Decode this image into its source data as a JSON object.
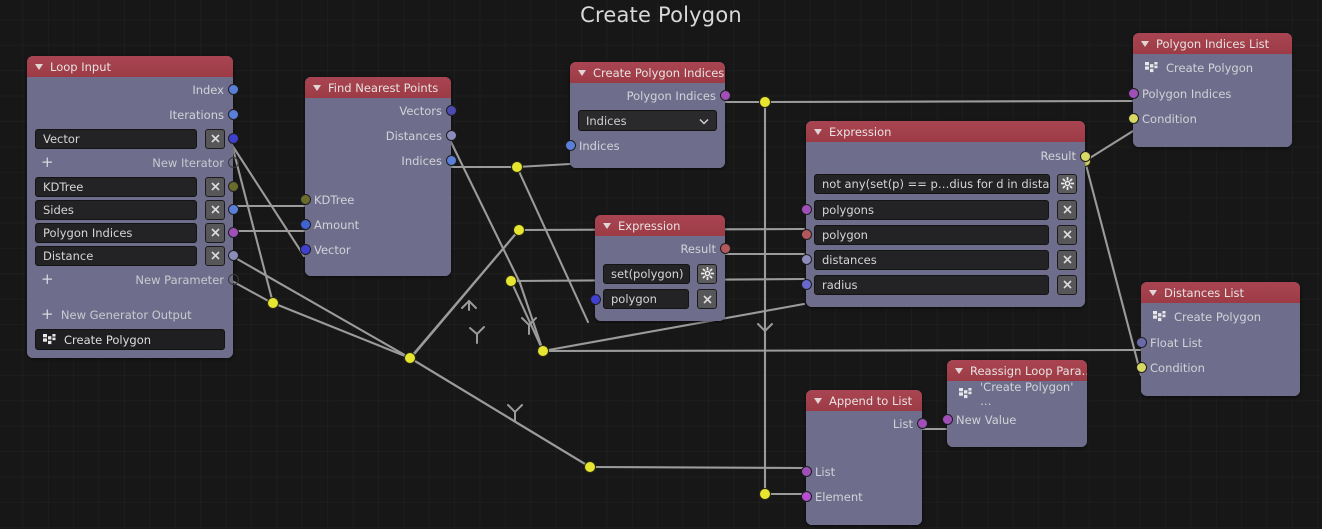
{
  "title": "Create Polygon",
  "colors": {
    "header": "#9c3b45",
    "body": "#6e6e8c",
    "link": "#9b9b9b",
    "reroute": "#e6e632",
    "socket_vector": "#6363c7",
    "socket_float": "#8c8cbb",
    "socket_int": "#5a7fd8",
    "socket_generic_blue": "#3f3fd0",
    "socket_kdtree": "#6b6b2e",
    "socket_list_purple": "#a14fb8",
    "socket_polygon": "#b5585e",
    "socket_boolean": "#cccc55",
    "background": "#171717"
  },
  "nodes": {
    "loop_input": {
      "title": "Loop Input",
      "outputs": [
        "Index",
        "Iterations"
      ],
      "iterator_fields": [
        "Vector"
      ],
      "new_iterator_label": "New Iterator",
      "parameter_fields": [
        "KDTree",
        "Sides",
        "Polygon Indices",
        "Distance"
      ],
      "new_parameter_label": "New Parameter",
      "new_generator_output_label": "New Generator Output",
      "subprogram_button": "Create Polygon"
    },
    "find_nearest_points": {
      "title": "Find Nearest Points",
      "outputs": [
        "Vectors",
        "Distances",
        "Indices"
      ],
      "inputs": [
        "KDTree",
        "Amount",
        "Vector"
      ]
    },
    "create_polygon_indices": {
      "title": "Create Polygon Indices",
      "outputs": [
        "Polygon Indices"
      ],
      "dropdown_value": "Indices",
      "inputs": [
        "Indices"
      ]
    },
    "expression_main": {
      "title": "Expression",
      "outputs": [
        "Result"
      ],
      "expression": "not any(set(p) == p…dius for d in distances)",
      "inputs": [
        "polygons",
        "polygon",
        "distances",
        "radius"
      ]
    },
    "expression_small": {
      "title": "Expression",
      "outputs": [
        "Result"
      ],
      "expression": "set(polygon)",
      "inputs": [
        "polygon"
      ]
    },
    "polygon_indices_list": {
      "title": "Polygon Indices List",
      "subtitle": "Create Polygon",
      "inputs": [
        "Polygon Indices",
        "Condition"
      ]
    },
    "distances_list": {
      "title": "Distances List",
      "subtitle": "Create Polygon",
      "inputs": [
        "Float List",
        "Condition"
      ]
    },
    "reassign_loop_parameter": {
      "title": "Reassign Loop Para…",
      "subtitle": "'Create Polygon' …",
      "inputs": [
        "New Value"
      ]
    },
    "append_to_list": {
      "title": "Append to List",
      "outputs": [
        "List"
      ],
      "inputs": [
        "List",
        "Element"
      ]
    }
  }
}
